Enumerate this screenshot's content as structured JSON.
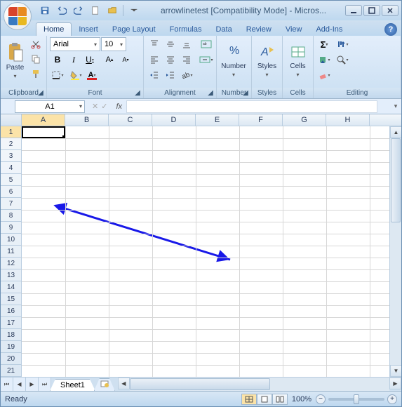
{
  "window": {
    "title": "arrowlinetest  [Compatibility Mode] - Micros..."
  },
  "qat": {
    "save": "Save",
    "undo": "Undo",
    "redo": "Redo",
    "new": "New",
    "open": "Open"
  },
  "tabs": [
    "Home",
    "Insert",
    "Page Layout",
    "Formulas",
    "Data",
    "Review",
    "View",
    "Add-Ins"
  ],
  "active_tab": 0,
  "ribbon": {
    "clipboard": {
      "label": "Clipboard",
      "paste": "Paste"
    },
    "font": {
      "label": "Font",
      "name": "Arial",
      "size": "10",
      "btns": [
        "B",
        "I",
        "U"
      ]
    },
    "alignment": {
      "label": "Alignment"
    },
    "number": {
      "label": "Number",
      "btn": "Number"
    },
    "styles": {
      "label": "Styles",
      "btn": "Styles"
    },
    "cells": {
      "label": "Cells",
      "btn": "Cells"
    },
    "editing": {
      "label": "Editing"
    }
  },
  "formulabar": {
    "namebox": "A1",
    "fx": "fx",
    "value": ""
  },
  "columns": [
    "A",
    "B",
    "C",
    "D",
    "E",
    "F",
    "G",
    "H"
  ],
  "rows": [
    "1",
    "2",
    "3",
    "4",
    "5",
    "6",
    "7",
    "8",
    "9",
    "10",
    "11",
    "12",
    "13",
    "14",
    "15",
    "16",
    "17",
    "18",
    "19",
    "20",
    "21"
  ],
  "selected_cell": "A1",
  "sheets": {
    "active": "Sheet1"
  },
  "statusbar": {
    "ready": "Ready",
    "zoom": "100%"
  },
  "shape": {
    "type": "double-arrow-line",
    "color": "#1818e8"
  }
}
